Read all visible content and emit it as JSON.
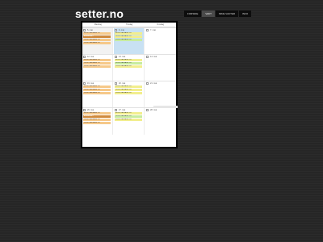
{
  "site": {
    "title": "setter.no"
  },
  "nav": {
    "items": [
      "FORSIDE",
      "VAKT",
      "MINE VAKTER",
      "INFO"
    ],
    "active_index": 1
  },
  "calendar": {
    "headers": [
      "Mandag",
      "Tirsdag",
      "Onsdag"
    ],
    "weeks": [
      {
        "side_number": "",
        "days": [
          {
            "label": "5. mai",
            "state": "past",
            "events": [
              {
                "text": "08:00 KLARVANN 1-4",
                "color": "orange"
              },
              {
                "text": "ANNANVAKT",
                "color": "dark"
              },
              {
                "text": "16:00 KLARVANN 1-4",
                "color": "orange"
              },
              {
                "text": "20:00 KLARVANN 5-8",
                "color": "orange"
              }
            ]
          },
          {
            "label": "6. mai",
            "state": "today",
            "events": [
              {
                "text": "08:00 KLARVANN 1-4",
                "color": "yellow"
              },
              {
                "text": "16:00 KLARVANN 1-4",
                "color": "yellow"
              },
              {
                "text": "20:00 KLARVANN 5-8",
                "color": "green"
              }
            ]
          },
          {
            "label": "7. mai",
            "state": "normal",
            "events": []
          }
        ]
      },
      {
        "side_number": "",
        "days": [
          {
            "label": "12. mai",
            "state": "normal",
            "events": [
              {
                "text": "08:00 KLARVANN 1-4",
                "color": "orange"
              },
              {
                "text": "16:00 KLARVANN 1-4",
                "color": "orange"
              },
              {
                "text": "20:00 KLARVANN 5-8",
                "color": "orange"
              }
            ]
          },
          {
            "label": "13. mai",
            "state": "normal",
            "events": [
              {
                "text": "08:00 KLARVANN 1-4",
                "color": "yellow"
              },
              {
                "text": "16:00 KLARVANN 1-4",
                "color": "green"
              },
              {
                "text": "20:00 KLARVANN 5-8",
                "color": "yellow"
              }
            ]
          },
          {
            "label": "14. mai",
            "state": "normal",
            "events": []
          }
        ]
      },
      {
        "side_number": "",
        "days": [
          {
            "label": "19. mai",
            "state": "normal",
            "events": [
              {
                "text": "08:00 KLARVANN 1-4",
                "color": "orange"
              },
              {
                "text": "16:00 KLARVANN 1-4",
                "color": "orange"
              },
              {
                "text": "20:00 KLARVANN 5-8",
                "color": "orange"
              }
            ]
          },
          {
            "label": "20. mai",
            "state": "normal",
            "events": [
              {
                "text": "08:00 KLARVANN 1-4",
                "color": "yellow"
              },
              {
                "text": "16:00 KLARVANN 1-4",
                "color": "yellow"
              },
              {
                "text": "20:00 KLARVANN 5-8",
                "color": "yellow"
              }
            ]
          },
          {
            "label": "21. mai",
            "state": "normal",
            "events": []
          }
        ]
      },
      {
        "side_number": "",
        "days": [
          {
            "label": "26. mai",
            "state": "normal",
            "events": [
              {
                "text": "08:00 KLARVANN 1-4",
                "color": "orange"
              },
              {
                "text": "ANNANVAKT",
                "color": "dark"
              },
              {
                "text": "16:00 KLARVANN 1-4",
                "color": "orange"
              },
              {
                "text": "20:00 KLARVANN 5-8",
                "color": "orange"
              }
            ]
          },
          {
            "label": "27. mai",
            "state": "normal",
            "events": [
              {
                "text": "08:00 KLARVANN 1-4",
                "color": "yellow"
              },
              {
                "text": "16:00 KLARVANN 1-4",
                "color": "green"
              },
              {
                "text": "20:00 KLARVANN 5-8",
                "color": "yellow"
              }
            ]
          },
          {
            "label": "28. mai",
            "state": "normal",
            "events": []
          }
        ]
      }
    ]
  },
  "colors": {
    "orange": "#f6c98a",
    "yellow": "#f2ee8e",
    "green": "#c7ec9e",
    "today": "#c8e1f3",
    "accent_dark": "#d08a3c"
  }
}
